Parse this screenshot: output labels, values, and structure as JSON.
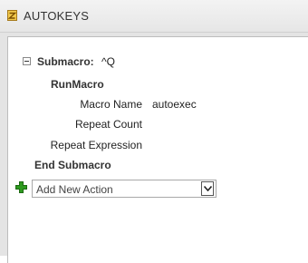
{
  "window": {
    "title": "AUTOKEYS",
    "title_icon": "macro-icon"
  },
  "macro": {
    "submacro_keyword": "Submacro:",
    "submacro_name": "^Q",
    "action_name": "RunMacro",
    "arguments": [
      {
        "label": "Macro Name",
        "value": "autoexec"
      },
      {
        "label": "Repeat Count",
        "value": ""
      },
      {
        "label": "Repeat Expression",
        "value": ""
      }
    ],
    "end_keyword": "End Submacro"
  },
  "add_action": {
    "icon": "green-plus-icon",
    "placeholder": "Add New Action",
    "dropdown_icon": "chevron-down-icon"
  },
  "colors": {
    "plus_green": "#2e9a1f",
    "title_icon_gold": "#d9a520"
  }
}
